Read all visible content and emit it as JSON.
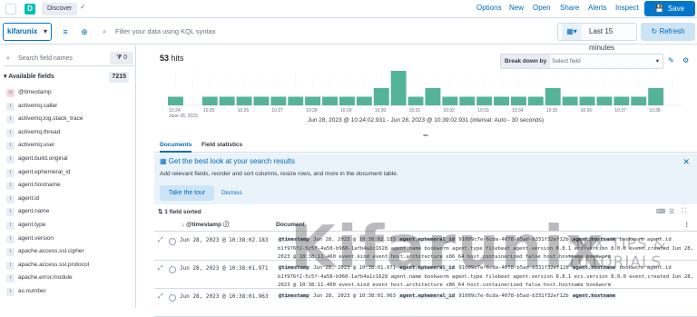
{
  "topbar": {
    "breadcrumb": "Discover",
    "nav": [
      "Options",
      "New",
      "Open",
      "Share",
      "Alerts",
      "Inspect"
    ],
    "save_label": "Save"
  },
  "querybar": {
    "data_view": "kifarunix",
    "kql_placeholder": "Filter your data using KQL syntax",
    "date_range": "Last 15 minutes",
    "refresh_label": "Refresh"
  },
  "sidebar": {
    "search_placeholder": "Search field names",
    "filter_count": "0",
    "section_title": "Available fields",
    "section_count": "7215",
    "fields": [
      "@timestamp",
      "activemq.caller",
      "activemq.log.stack_trace",
      "activemq.thread",
      "activemq.user",
      "agent.build.original",
      "agent.ephemeral_id",
      "agent.hostname",
      "agent.id",
      "agent.name",
      "agent.type",
      "agent.version",
      "apache.access.ssl.cipher",
      "apache.access.ssl.protocol",
      "apache.error.module",
      "as.number"
    ]
  },
  "main": {
    "hits_count": "53",
    "hits_unit": "hits",
    "breakdown_label": "Break down by",
    "breakdown_placeholder": "Select field",
    "interval_text": "Jun 28, 2023 @ 10:24:02.931 - Jun 28, 2023 @ 10:39:02.931 (interval: Auto - 30 seconds)",
    "tabs": [
      "Documents",
      "Field statistics"
    ],
    "callout": {
      "title": "Get the best look at your search results",
      "text": "Add relevant fields, reorder and sort columns, resize rows, and more in the document table.",
      "tour_label": "Take the tour",
      "dismiss_label": "Dismiss"
    },
    "sorted_label": "1 field sorted",
    "col_timestamp": "@timestamp",
    "col_document": "Document",
    "rows": [
      {
        "ts": "Jun 28, 2023 @ 10:38:02.183",
        "ts_doc": "Jun 28, 2023 @ 10:38:02.183",
        "l1": "91009c7e-6cda-4078-b5ad-b331f32ef12b",
        "l2": "bookworm agent.id b1f976f2-5c5f-4a58-b960-1afb4a1c1628 agent.name bookworm agent.type filebeat agent.version 8.8.1 ecs.version 8.0.0 event.created Jun 28, 2023 @ 10:38:11.460 event.kind event host.architecture x86_64 host.containerized false host.hostname bookworm"
      },
      {
        "ts": "Jun 28, 2023 @ 10:38:01.971",
        "ts_doc": "Jun 28, 2023 @ 10:38:01.971",
        "l1": "91009c7e-6cda-4078-b5ad-b331f32ef12b",
        "l2": "bookworm agent.id b1f976f2-5c5f-4a58-b960-1afb4a1c1628 agent.name bookworm agent.type filebeat agent.version 8.8.1 ecs.version 8.0.0 event.created Jun 28, 2023 @ 10:38:11.460 event.kind event host.architecture x86_64 host.containerized false host.hostname bookworm"
      },
      {
        "ts": "Jun 28, 2023 @ 10:38:01.963",
        "ts_doc": "Jun 28, 2023 @ 10:38:01.963",
        "l1": "91009c7e-6cda-4078-b5ad-b331f32ef12b",
        "l2": ""
      }
    ],
    "doc_keys": [
      "@timestamp",
      "agent.ephemeral_id",
      "agent.hostname"
    ]
  },
  "watermark": {
    "main": "Kifarunix",
    "sub": "*NIX TIPS & TUTORIALS"
  },
  "chart_data": {
    "type": "bar",
    "color": "#54b399",
    "x": [
      "10:24",
      "10:24:30",
      "10:25",
      "10:25:30",
      "10:26",
      "10:26:30",
      "10:27",
      "10:27:30",
      "10:28",
      "10:28:30",
      "10:29",
      "10:29:30",
      "10:30",
      "10:30:30",
      "10:31",
      "10:31:30",
      "10:32",
      "10:32:30",
      "10:33",
      "10:33:30",
      "10:34",
      "10:34:30",
      "10:35",
      "10:35:30",
      "10:36",
      "10:36:30",
      "10:37",
      "10:37:30",
      "10:38",
      "10:38:30"
    ],
    "values": [
      1,
      0,
      1,
      1,
      1,
      1,
      1,
      1,
      1,
      1,
      1,
      1,
      2,
      4,
      1,
      2,
      1,
      1,
      1,
      1,
      1,
      1,
      2,
      1,
      1,
      1,
      1,
      1,
      2,
      0
    ],
    "tick_labels": [
      "10:24\nJune 28, 2023",
      "10:25",
      "10:26",
      "10:27",
      "10:28",
      "10:29",
      "10:30",
      "10:31",
      "10:32",
      "10:33",
      "10:34",
      "10:35",
      "10:36",
      "10:37",
      "10:38"
    ]
  }
}
